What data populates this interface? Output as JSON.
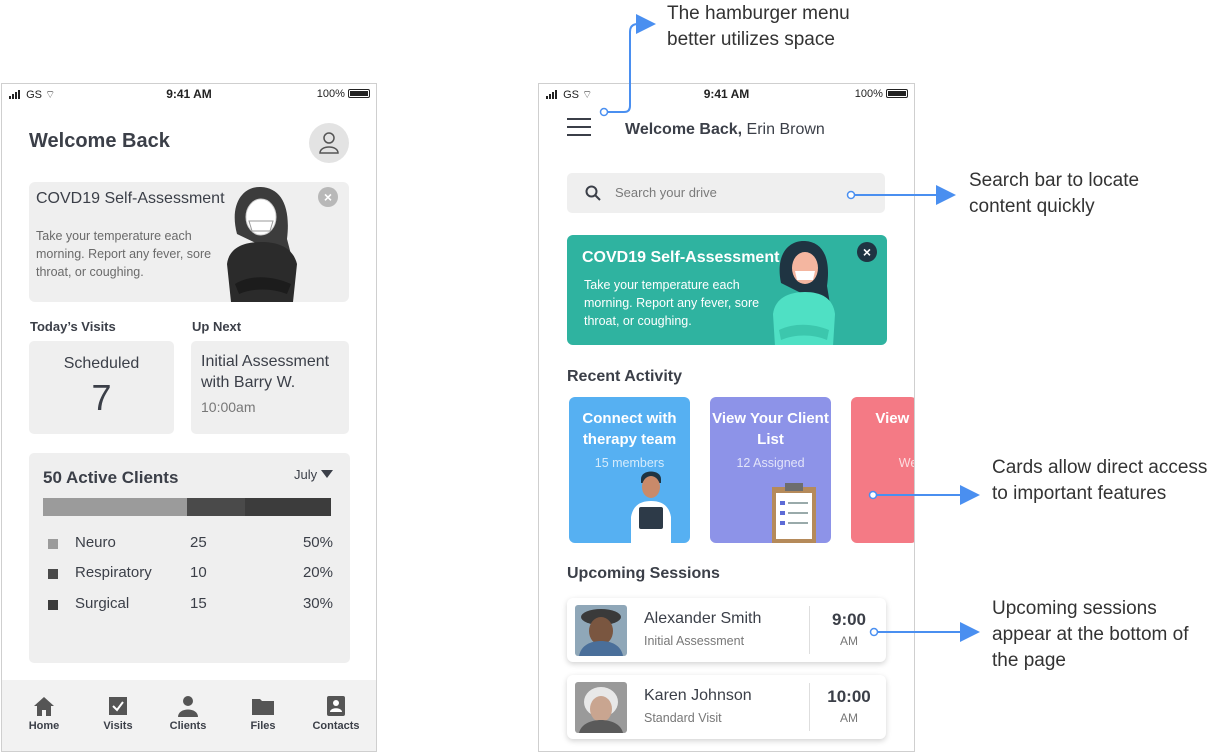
{
  "status_bar": {
    "carrier": "GS",
    "time": "9:41 AM",
    "battery": "100%"
  },
  "left": {
    "title": "Welcome Back",
    "covid": {
      "title": "COVD19 Self-Assessment",
      "text": "Take your temperature each morning. Report any fever, sore throat,  or coughing.",
      "close": "×"
    },
    "todays_visits_label": "Today’s Visits",
    "up_next_label": "Up Next",
    "scheduled_label": "Scheduled",
    "scheduled_count": "7",
    "up_next_title": "Initial Assessment with Barry W.",
    "up_next_time": "10:00am",
    "clients": {
      "title": "50 Active Clients",
      "month": "July",
      "rows": [
        {
          "name": "Neuro",
          "count": "25",
          "percent": "50%",
          "share": 0.5,
          "color": "#9b9b9b"
        },
        {
          "name": "Respiratory",
          "count": "10",
          "percent": "20%",
          "share": 0.2,
          "color": "#4a4a4a"
        },
        {
          "name": "Surgical",
          "count": "15",
          "percent": "30%",
          "share": 0.3,
          "color": "#3c3c3c"
        }
      ]
    },
    "tabs": [
      {
        "label": "Home",
        "icon": "home-icon"
      },
      {
        "label": "Visits",
        "icon": "check-icon"
      },
      {
        "label": "Clients",
        "icon": "person-icon"
      },
      {
        "label": "Files",
        "icon": "folder-icon"
      },
      {
        "label": "Contacts",
        "icon": "contact-card-icon"
      }
    ]
  },
  "right": {
    "welcome_prefix": "Welcome Back,",
    "user_name": "Erin Brown",
    "search_placeholder": "Search your drive",
    "covid": {
      "title": "COVD19 Self-Assessment",
      "text": "Take your temperature each morning. Report any fever, sore throat,  or coughing.",
      "close": "×"
    },
    "recent_activity_label": "Recent Activity",
    "cards": [
      {
        "title": "Connect with therapy team",
        "subtitle": "15 members",
        "color": "#56b0f2"
      },
      {
        "title": "View Your Client List",
        "subtitle": "12 Assigned",
        "color": "#8d93e8"
      },
      {
        "title": "View Prod",
        "subtitle": "Wee",
        "color": "#f47a85"
      }
    ],
    "upcoming_label": "Upcoming Sessions",
    "sessions": [
      {
        "name": "Alexander Smith",
        "type": "Initial Assessment",
        "time": "9:00",
        "ampm": "AM"
      },
      {
        "name": "Karen Johnson",
        "type": "Standard Visit",
        "time": "10:00",
        "ampm": "AM"
      }
    ]
  },
  "annotations": {
    "hamburger": "The hamburger menu better utilizes space",
    "search": "Search bar to locate content quickly",
    "cards": "Cards allow direct access to important features",
    "sessions": "Upcoming sessions appear at the bottom of the page"
  },
  "colors": {
    "accent_teal": "#2fb3a0",
    "connector_blue": "#4a8ff0",
    "text_dark": "#3b3f48"
  }
}
